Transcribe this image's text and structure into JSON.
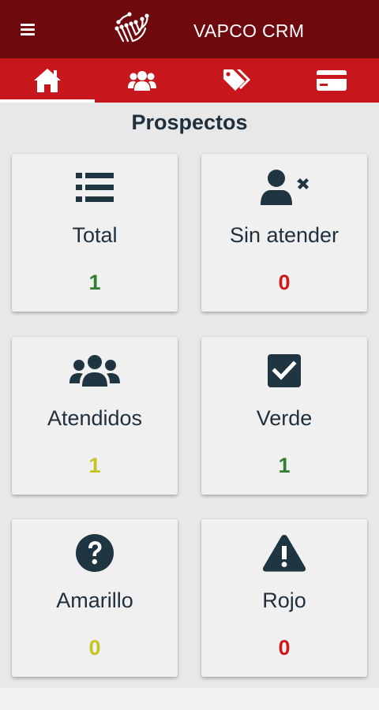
{
  "app": {
    "title": "VAPCO CRM"
  },
  "tabs": [
    {
      "icon": "home-icon",
      "active": true
    },
    {
      "icon": "users-icon",
      "active": false
    },
    {
      "icon": "tags-icon",
      "active": false
    },
    {
      "icon": "credit-card-icon",
      "active": false
    }
  ],
  "section": {
    "title": "Prospectos"
  },
  "cards": [
    {
      "label": "Total",
      "value": "1",
      "icon": "list-icon",
      "value_color": "#2e7d32"
    },
    {
      "label": "Sin atender",
      "value": "0",
      "icon": "user-times-icon",
      "value_color": "#cc1a1a"
    },
    {
      "label": "Atendidos",
      "value": "1",
      "icon": "users-icon",
      "value_color": "#c4c41e"
    },
    {
      "label": "Verde",
      "value": "1",
      "icon": "check-square-icon",
      "value_color": "#2e7d32"
    },
    {
      "label": "Amarillo",
      "value": "0",
      "icon": "question-circle-icon",
      "value_color": "#c4c41e"
    },
    {
      "label": "Rojo",
      "value": "0",
      "icon": "warning-icon",
      "value_color": "#cc1a1a"
    }
  ],
  "colors": {
    "appbar": "#6e0a0e",
    "tabbar": "#c8161d",
    "icon_dark": "#1f3542"
  }
}
